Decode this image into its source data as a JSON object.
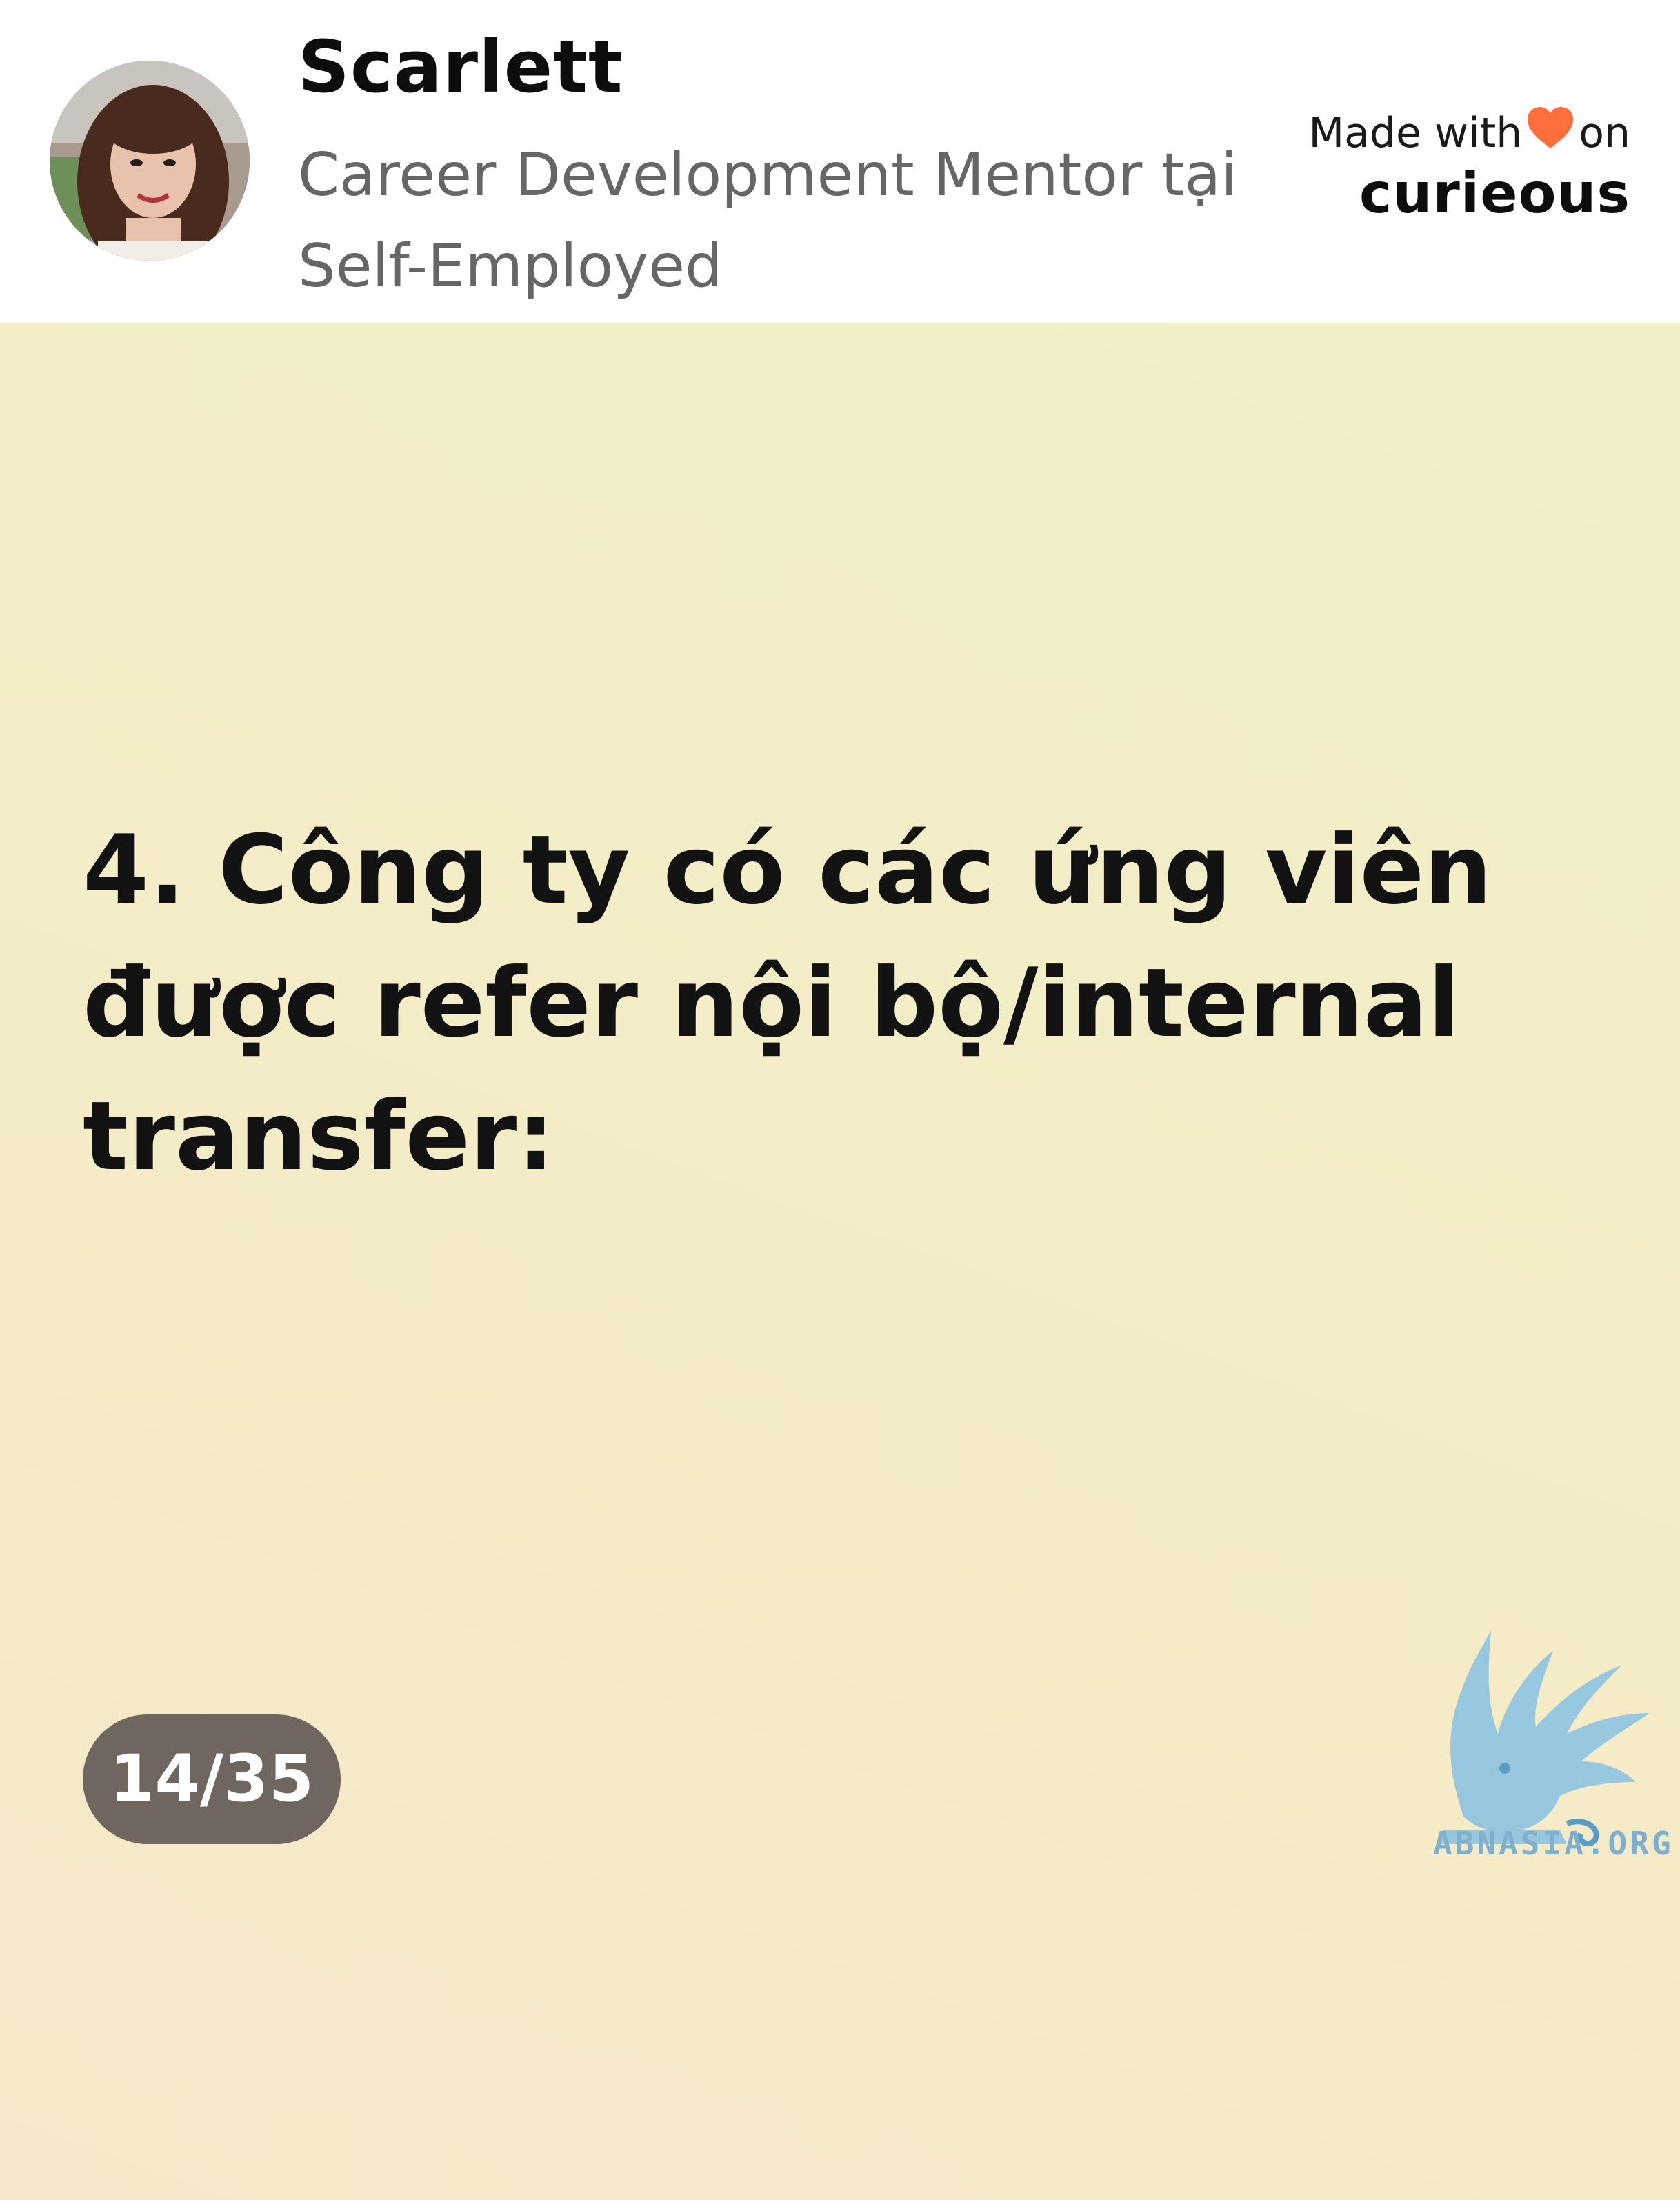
{
  "header": {
    "name": "Scarlett",
    "subtitle": "Career Development Mentor tại Self-Employed",
    "made_with_prefix": "Made with",
    "made_with_suffix": "on",
    "brand": "curieous",
    "heart_icon": "heart-icon",
    "heart_color": "#ff6f3c"
  },
  "card": {
    "text": "4. Công ty có các ứng viên được refer nội bộ/internal transfer:",
    "page_counter": "14/35",
    "background_colors": [
      "#f1f0c9",
      "#f7e7c8"
    ]
  },
  "watermark": {
    "text": "ABNASIA.ORG",
    "logo_icon": "griffin-logo-icon",
    "color": "#7fb0cf"
  }
}
